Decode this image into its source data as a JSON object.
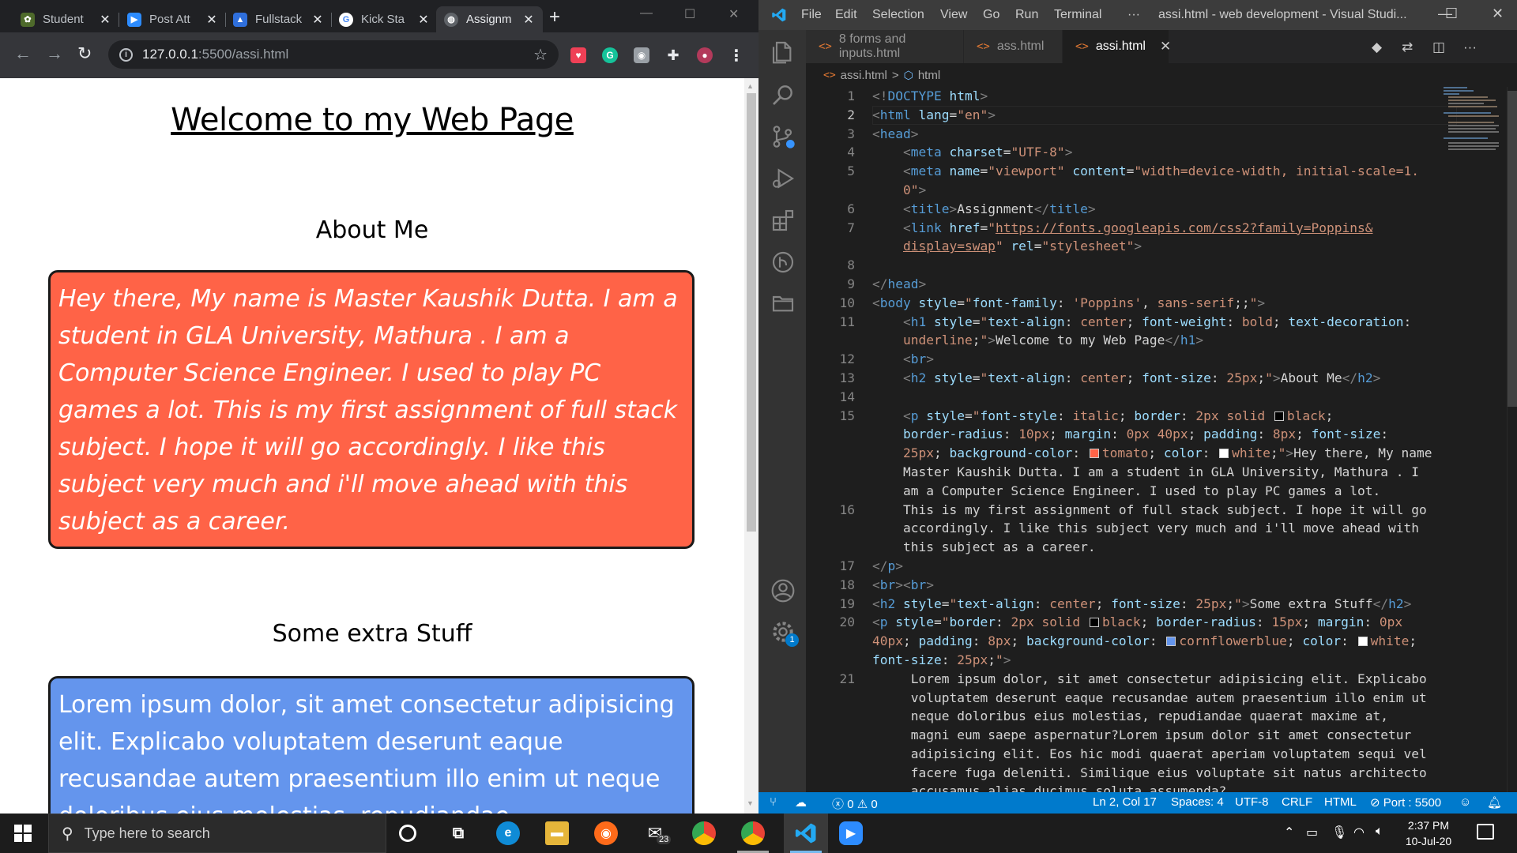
{
  "browser": {
    "tabs": [
      {
        "label": "Student",
        "fav_color": "#4e6a2b",
        "fav_glyph": "✿"
      },
      {
        "label": "Post Att",
        "fav_color": "#2d8cff",
        "fav_glyph": "▶"
      },
      {
        "label": "Fullstack",
        "fav_color": "#2f6fdc",
        "fav_glyph": "▲"
      },
      {
        "label": "Kick Sta",
        "fav_color": "#ffffff",
        "fav_glyph": "G"
      },
      {
        "label": "Assignm",
        "fav_color": "#5f6368",
        "fav_glyph": "◍"
      }
    ],
    "new_tab": "+",
    "url_host": "127.0.0.1",
    "url_rest": ":5500/assi.html",
    "extensions": [
      "pocket",
      "grammarly",
      "camera",
      "puzzle",
      "profile"
    ]
  },
  "page": {
    "h1": "Welcome to my Web Page",
    "about_heading": "About Me",
    "about_text": "Hey there, My name is Master Kaushik Dutta. I am a student in GLA University, Mathura . I am a Computer Science Engineer. I used to play PC games a lot. This is my first assignment of full stack subject. I hope it will go accordingly. I like this subject very much and i'll move ahead with this subject as a career.",
    "extra_heading": "Some extra Stuff",
    "extra_text": "Lorem ipsum dolor, sit amet consectetur adipisicing elit. Explicabo voluptatem deserunt eaque recusandae autem praesentium illo enim ut neque doloribus eius molestias, repudiandae",
    "colors": {
      "about_bg": "#ff6347",
      "extra_bg": "#6495ed"
    }
  },
  "vscode": {
    "menu": [
      "File",
      "Edit",
      "Selection",
      "View",
      "Go",
      "Run",
      "Terminal",
      "···"
    ],
    "title": "assi.html - web development - Visual Studi...",
    "editor_tabs": [
      {
        "label": "8 forms and inputs.html"
      },
      {
        "label": "ass.html"
      },
      {
        "label": "assi.html",
        "close": "✕"
      }
    ],
    "breadcrumb": {
      "file": "assi.html",
      "sep": ">",
      "node": "html"
    },
    "line_numbers": [
      "1",
      "2",
      "3",
      "4",
      "5",
      "",
      "6",
      "7",
      "",
      "8",
      "9",
      "10",
      "11",
      "",
      "12",
      "13",
      "14",
      "15",
      "",
      "",
      "",
      "",
      "16",
      "",
      "",
      "17",
      "18",
      "19",
      "20",
      "",
      "",
      "21",
      "",
      "",
      "",
      "",
      "",
      ""
    ],
    "status": {
      "problems_errors": "0",
      "problems_warnings": "0",
      "position": "Ln 2, Col 17",
      "spaces": "Spaces: 4",
      "encoding": "UTF-8",
      "eol": "CRLF",
      "language": "HTML",
      "port": "Port : 5500"
    },
    "badge": "1"
  },
  "taskbar": {
    "search_placeholder": "Type here to search",
    "mail_badge": "23",
    "time": "2:37 PM",
    "date": "10-Jul-20"
  }
}
